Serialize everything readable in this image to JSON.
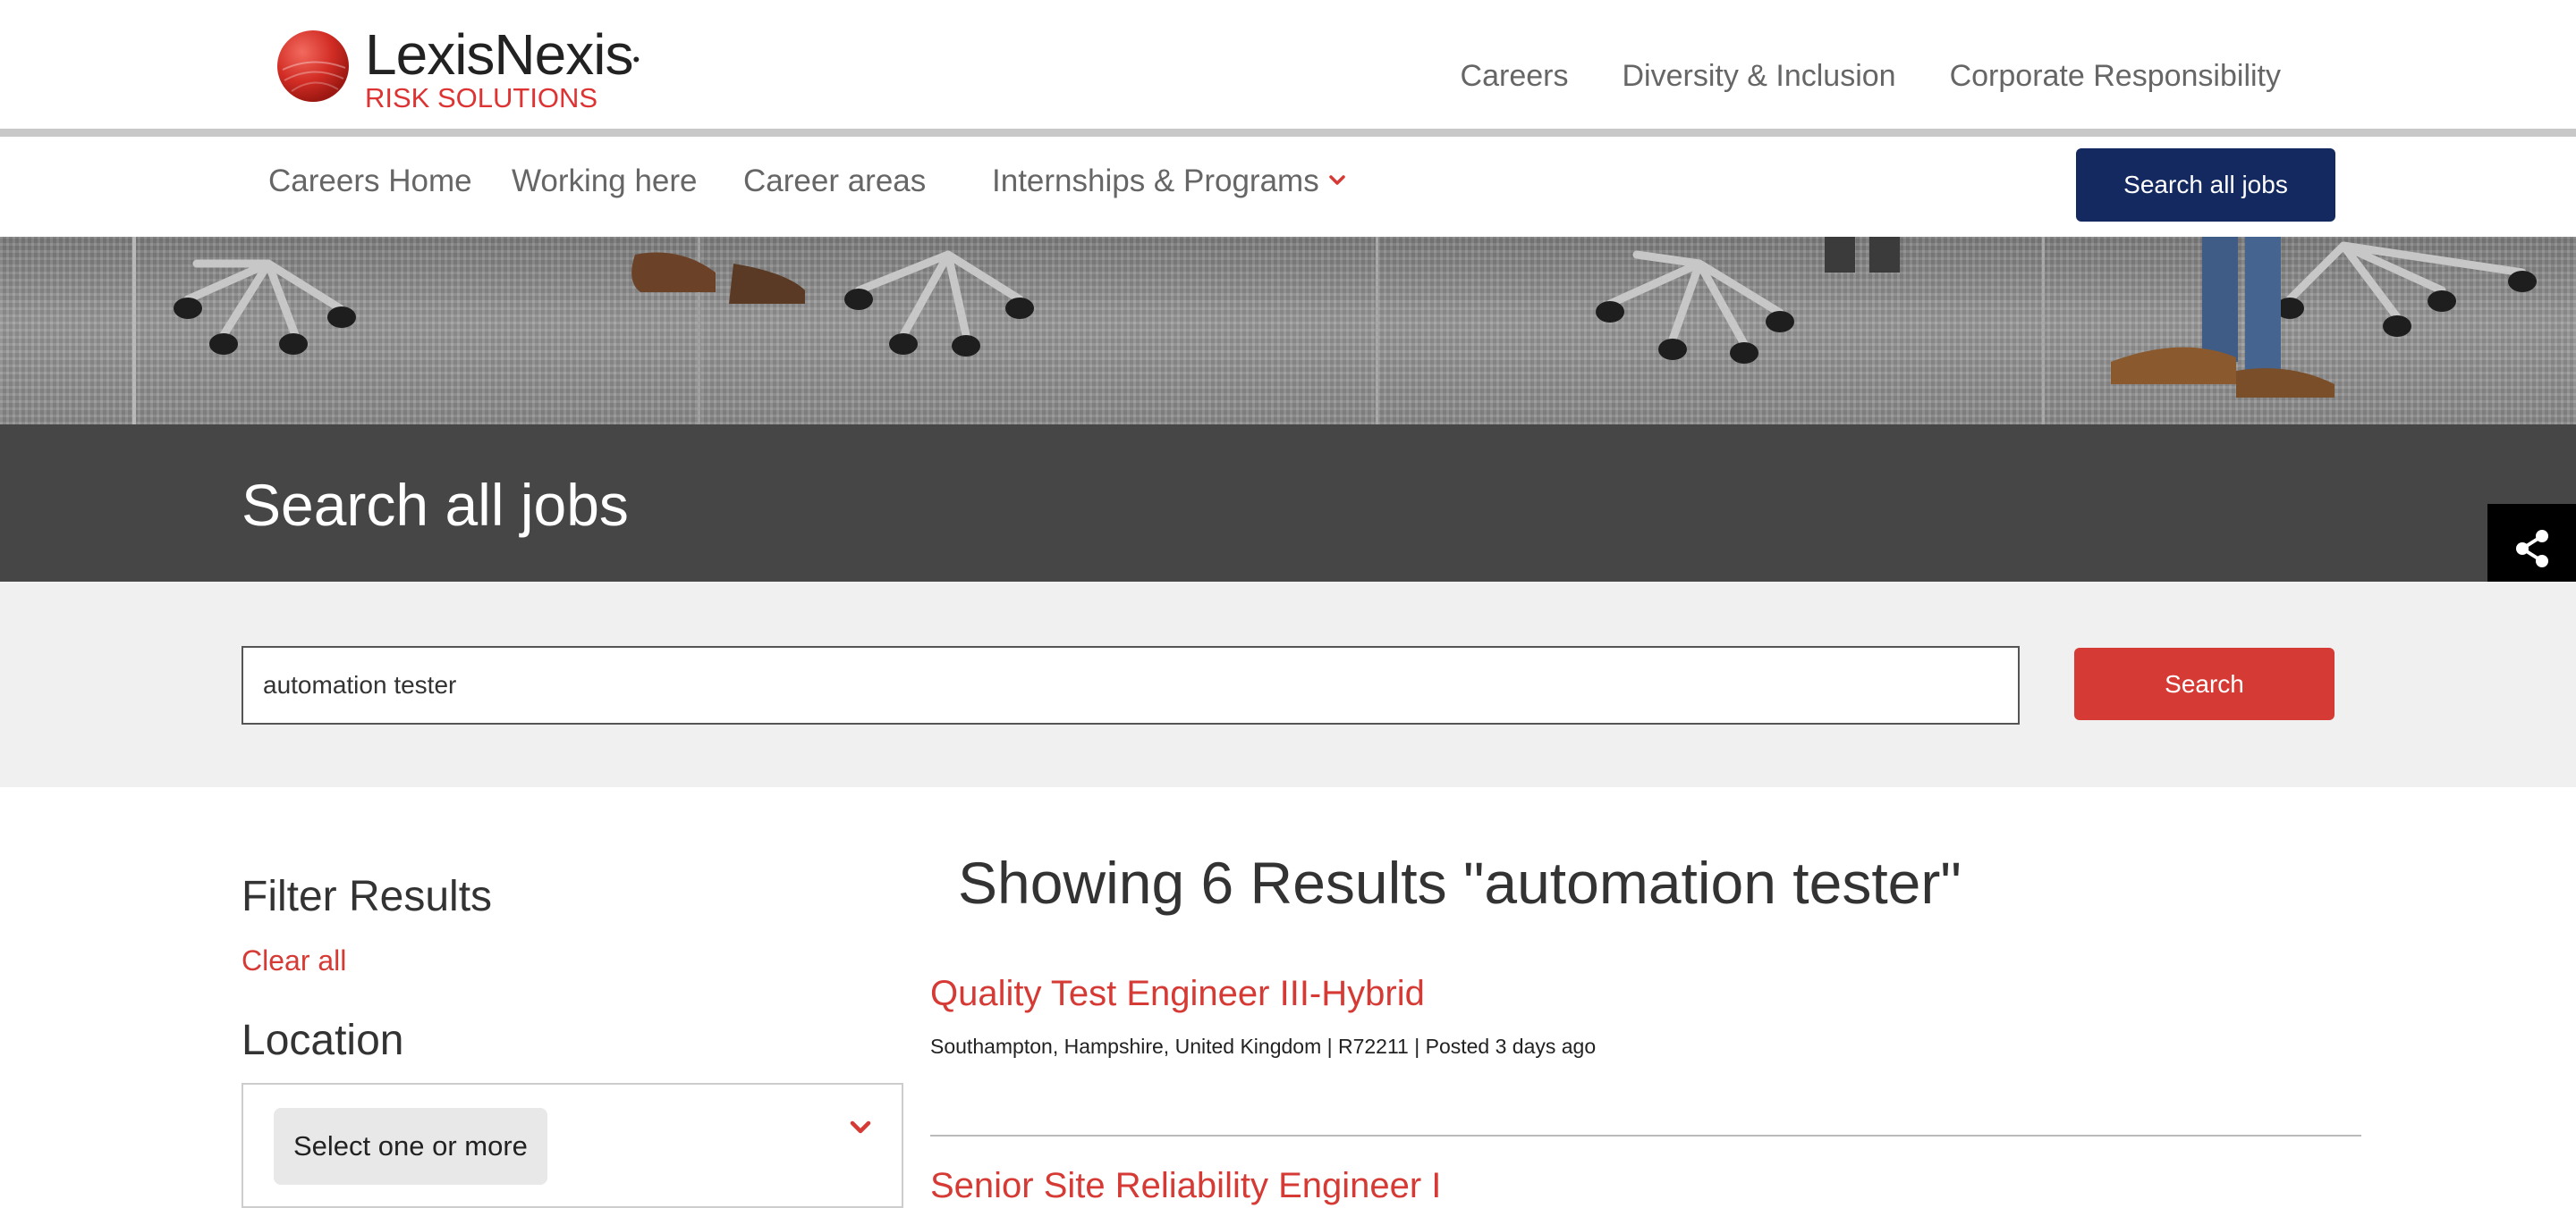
{
  "header": {
    "logo_name": "LexisNexis",
    "logo_sub": "RISK SOLUTIONS",
    "nav": [
      {
        "label": "Careers"
      },
      {
        "label": "Diversity & Inclusion"
      },
      {
        "label": "Corporate Responsibility"
      }
    ]
  },
  "subnav": {
    "items": [
      {
        "label": "Careers Home"
      },
      {
        "label": "Working here"
      },
      {
        "label": "Career areas"
      },
      {
        "label": "Internships & Programs"
      }
    ],
    "search_all_jobs_button": "Search all jobs"
  },
  "page": {
    "title": "Search all jobs"
  },
  "search": {
    "value": "automation tester",
    "button_label": "Search"
  },
  "filters": {
    "title": "Filter Results",
    "clear_all": "Clear all",
    "location_title": "Location",
    "location_placeholder": "Select one or more"
  },
  "results": {
    "heading": "Showing 6 Results \"automation tester\"",
    "jobs": [
      {
        "title": "Quality Test Engineer III-Hybrid",
        "meta": "Southampton, Hampshire, United Kingdom | R72211 | Posted 3 days ago"
      },
      {
        "title": "Senior Site Reliability Engineer I"
      }
    ]
  },
  "colors": {
    "brand_red": "#d63a35",
    "navy": "#13295f",
    "title_band": "#464646",
    "search_band": "#f0f0f0"
  },
  "icons": [
    "lexisnexis-logo-icon",
    "chevron-down-icon",
    "share-icon"
  ]
}
